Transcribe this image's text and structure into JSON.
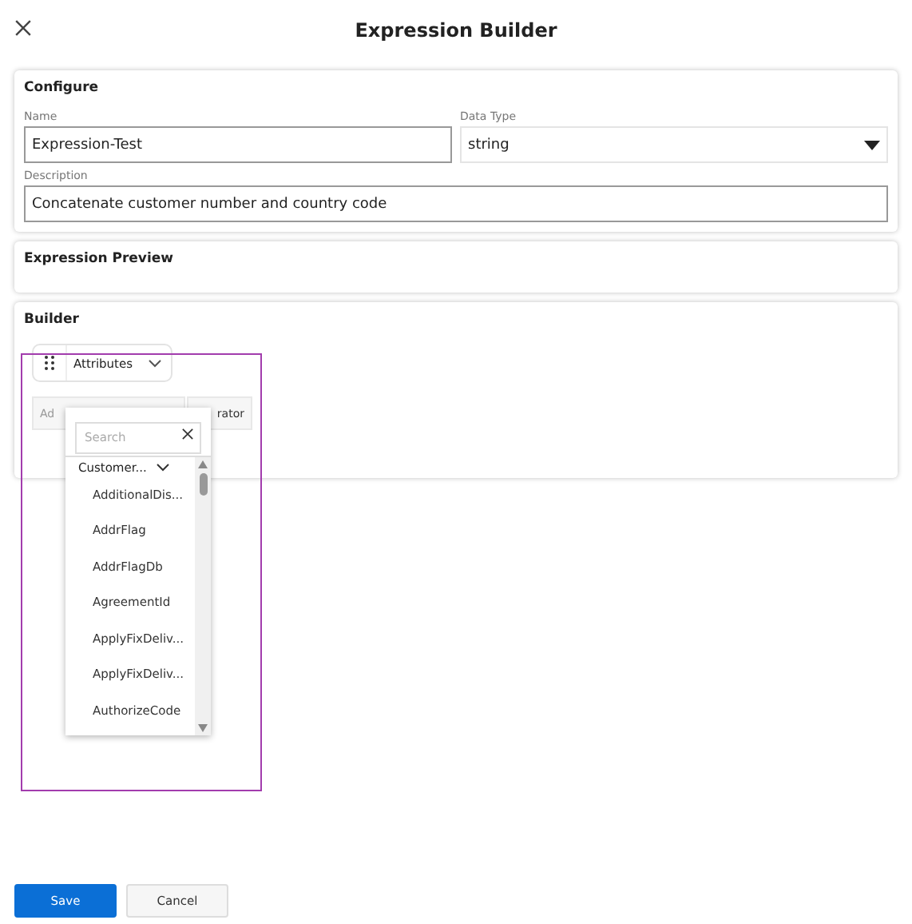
{
  "header": {
    "title": "Expression Builder"
  },
  "configure": {
    "title": "Configure",
    "name": {
      "label": "Name",
      "value": "Expression-Test"
    },
    "data_type": {
      "label": "Data Type",
      "value": "string"
    },
    "description": {
      "label": "Description",
      "value": "Concatenate customer number and country code"
    }
  },
  "preview": {
    "title": "Expression Preview"
  },
  "builder": {
    "title": "Builder",
    "block": {
      "label": "Attributes"
    },
    "buttons": [
      "Ad",
      "rator"
    ],
    "dropdown": {
      "search": {
        "placeholder": "Search"
      },
      "group": {
        "label": "Customer...",
        "expanded": true
      },
      "items": [
        "AdditionalDis...",
        "AddrFlag",
        "AddrFlagDb",
        "AgreementId",
        "ApplyFixDeliv...",
        "ApplyFixDeliv...",
        "AuthorizeCode"
      ]
    }
  },
  "footer": {
    "buttons": [
      {
        "label": "Save",
        "kind": "primary"
      },
      {
        "label": "Cancel",
        "kind": "secondary"
      }
    ]
  }
}
